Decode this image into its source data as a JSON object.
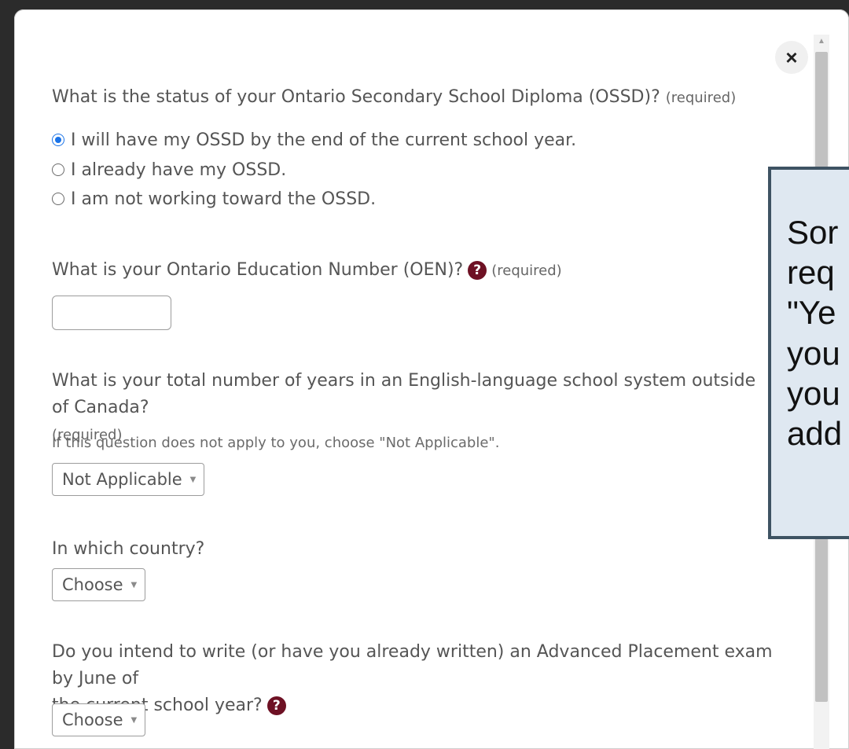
{
  "modal": {
    "close_label": "×",
    "questions": {
      "ossd": {
        "label": "What is the status of your Ontario Secondary School Diploma (OSSD)?",
        "required": "(required)",
        "options": [
          {
            "label": "I will have my OSSD by the end of the current school year.",
            "checked": true
          },
          {
            "label": "I already have my OSSD.",
            "checked": false
          },
          {
            "label": "I am not working toward the OSSD.",
            "checked": false
          }
        ]
      },
      "oen": {
        "label": "What is your Ontario Education Number (OEN)?",
        "help_icon": "?",
        "required": "(required)",
        "value": ""
      },
      "years_outside": {
        "label": "What is your total number of years in an English-language school system outside of Canada?",
        "required": "(required)",
        "hint": "If this question does not apply to you, choose \"Not Applicable\".",
        "selected": "Not Applicable"
      },
      "country": {
        "label": "In which country?",
        "selected": "Choose"
      },
      "ap_exam": {
        "label_line1": "Do you intend to write (or have you already written) an Advanced Placement exam by June of",
        "label_line2": "the current school year?",
        "help_icon": "?",
        "selected": "Choose"
      }
    }
  },
  "tooltip": {
    "lines": [
      "Sor",
      "req",
      "\"Ye",
      "you",
      "you",
      "add"
    ]
  },
  "colors": {
    "radio_checked": "#1a73e8",
    "help_icon": "#6e1124",
    "tooltip_bg": "#dfe8f1",
    "tooltip_border": "#3e5363"
  },
  "icons": {
    "close": "close-icon",
    "help": "help-icon",
    "select_caret": "caret-down-icon"
  }
}
